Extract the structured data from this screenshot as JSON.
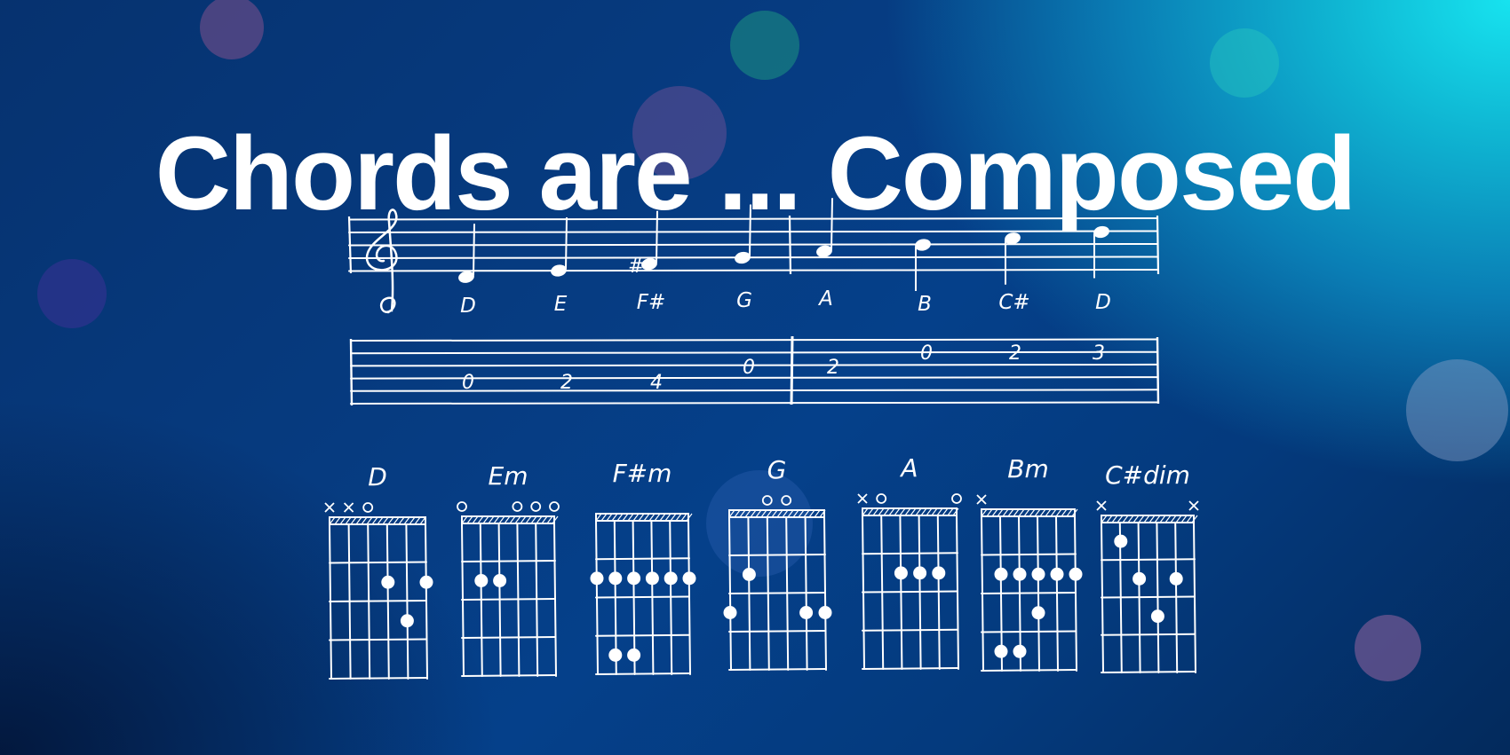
{
  "title": "Chords are ... Composed",
  "colors": {
    "ink": "#ffffff",
    "accent": "#17e3ef",
    "background": "#05408a"
  },
  "staff": {
    "clef": "treble-clef",
    "notes": [
      {
        "name": "D",
        "accidental": ""
      },
      {
        "name": "E",
        "accidental": ""
      },
      {
        "name": "F#",
        "accidental": "#"
      },
      {
        "name": "G",
        "accidental": ""
      },
      {
        "name": "A",
        "accidental": ""
      },
      {
        "name": "B",
        "accidental": ""
      },
      {
        "name": "C#",
        "accidental": ""
      },
      {
        "name": "D",
        "accidental": ""
      }
    ]
  },
  "tab": {
    "frets": [
      "0",
      "2",
      "4",
      "0",
      "2",
      "0",
      "2",
      "3"
    ]
  },
  "chords": [
    {
      "name": "D",
      "markers": [
        "x",
        "x",
        "o",
        "",
        "",
        ""
      ]
    },
    {
      "name": "Em",
      "markers": [
        "o",
        "",
        "",
        "o",
        "o",
        "o"
      ]
    },
    {
      "name": "F#m",
      "markers": [
        "",
        "",
        "",
        "",
        "",
        ""
      ]
    },
    {
      "name": "G",
      "markers": [
        "",
        "",
        "o",
        "o",
        "",
        ""
      ]
    },
    {
      "name": "A",
      "markers": [
        "x",
        "o",
        "",
        "",
        "",
        "o"
      ]
    },
    {
      "name": "Bm",
      "markers": [
        "x",
        "",
        "",
        "",
        "",
        ""
      ]
    },
    {
      "name": "C#dim",
      "markers": [
        "x",
        "",
        "",
        "",
        "",
        "x"
      ]
    }
  ]
}
